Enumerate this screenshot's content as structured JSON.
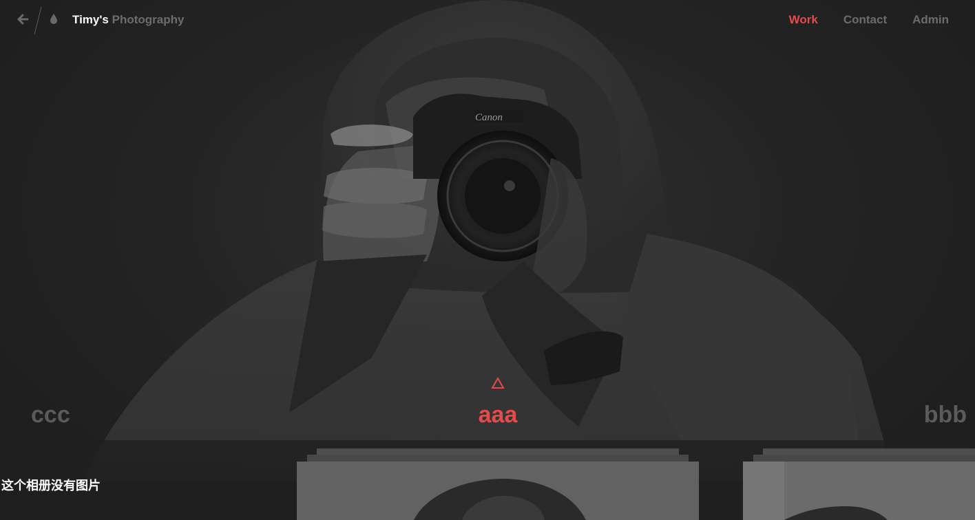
{
  "header": {
    "back_icon": "arrow-left-icon",
    "logo_icon": "drop-icon",
    "brand_name": "Timy's",
    "brand_sub": "Photography",
    "nav": [
      {
        "label": "Work",
        "active": true
      },
      {
        "label": "Contact",
        "active": false
      },
      {
        "label": "Admin",
        "active": false
      }
    ]
  },
  "albums": {
    "previous": "ccc",
    "current": "aaa",
    "next": "bbb",
    "current_indicator_icon": "triangle-up-icon"
  },
  "empty_message": "这个相册没有图片",
  "colors": {
    "accent": "#e84a4a",
    "muted": "#6c6c6c",
    "background": "#222222"
  }
}
